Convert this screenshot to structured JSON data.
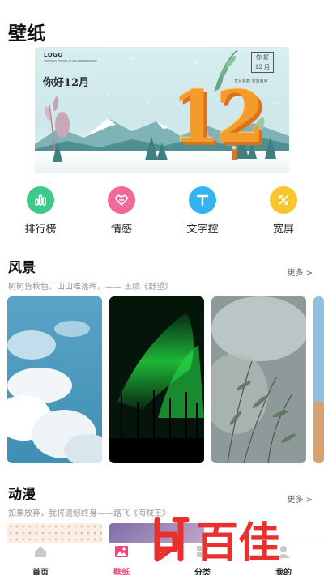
{
  "page": {
    "title": "壁纸"
  },
  "banner": {
    "logo": "LOGO",
    "logo_sub": "OVERSEAS VECTOR OF WALLPAPER DESIGN",
    "slogan": "你好12月",
    "stamp_line1": "你 好",
    "stamp_line2": "12 月",
    "caption": "岁月有痕 雪落有声",
    "number": "12",
    "colors": {
      "sky": "#cde7ea",
      "number": "#f39c2d"
    }
  },
  "categories": [
    {
      "label": "排行榜",
      "icon": "bar-chart-icon",
      "color": "#3ec98d"
    },
    {
      "label": "情感",
      "icon": "heart-chat-icon",
      "color": "#f2689a"
    },
    {
      "label": "文字控",
      "icon": "text-t-icon",
      "color": "#34b3f1"
    },
    {
      "label": "宽屏",
      "icon": "widescreen-icon",
      "color": "#f8c62a"
    }
  ],
  "sections": [
    {
      "title": "风景",
      "more": "更多",
      "subtitle": "树树皆秋色，山山唯落晖。—— 王绩《野望》"
    },
    {
      "title": "动漫",
      "more": "更多",
      "subtitle": "如果放弃，我将遗憾终身——路飞《海贼王》"
    }
  ],
  "nav": {
    "items": [
      {
        "label": "首页",
        "icon": "home-icon"
      },
      {
        "label": "壁纸",
        "icon": "wallpaper-icon",
        "active": true
      },
      {
        "label": "分类",
        "icon": "category-icon"
      },
      {
        "label": "我的",
        "icon": "profile-icon"
      }
    ],
    "active_color": "#f0437a"
  },
  "watermark": {
    "text": "百佳",
    "color": "#e8312f"
  }
}
